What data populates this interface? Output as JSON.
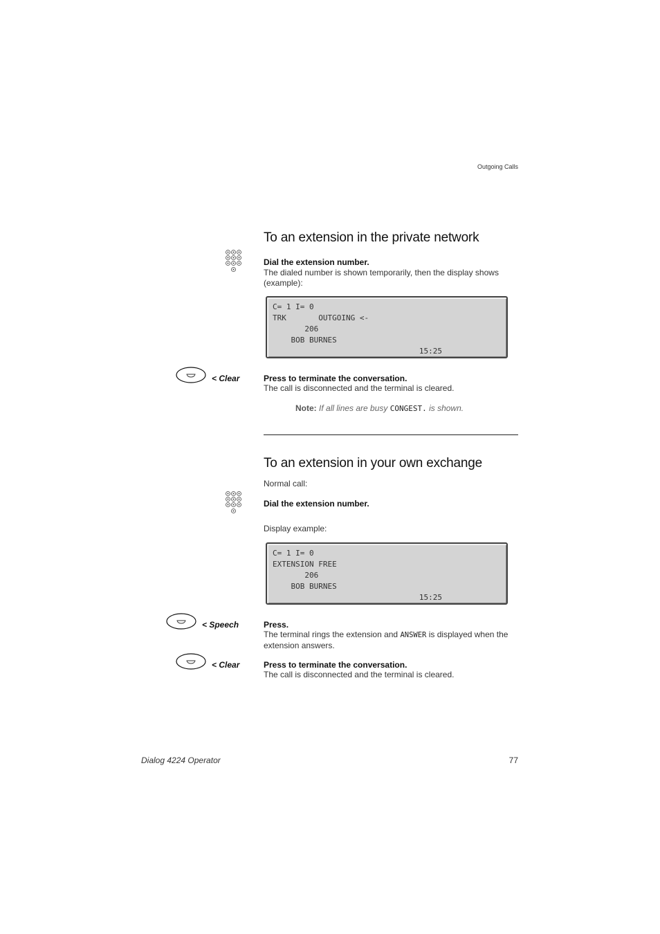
{
  "header": {
    "running_title": "Outgoing Calls"
  },
  "section1": {
    "title": "To an extension in the private network",
    "step1": {
      "icon": "keypad-icon",
      "heading": "Dial the extension number.",
      "text": "The dialed number is shown temporarily, then the display shows (example):"
    },
    "display": {
      "lines": [
        "C= 1 I= 0",
        "TRK       OUTGOING <-",
        "       206",
        "    BOB BURNES",
        "                                15:25"
      ]
    },
    "step2": {
      "icon": "key-button-icon",
      "key_label": "< Clear",
      "heading": "Press to terminate the conversation.",
      "text": "The call is disconnected and the terminal is cleared."
    },
    "note": {
      "label": "Note:",
      "text_before": "If all lines are busy",
      "code": "CONGEST.",
      "text_after": "is shown."
    }
  },
  "section2": {
    "title": "To an extension in your own exchange",
    "intro": "Normal call:",
    "step1": {
      "icon": "keypad-icon",
      "heading": "Dial the extension number."
    },
    "display_intro": "Display example:",
    "display": {
      "lines": [
        "C= 1 I= 0",
        "EXTENSION FREE",
        "       206",
        "    BOB BURNES",
        "                                15:25"
      ]
    },
    "step2": {
      "icon": "key-button-icon",
      "key_label": "< Speech",
      "heading": "Press.",
      "text_before": "The terminal rings the extension and",
      "code": "ANSWER",
      "text_after": "is displayed when the extension answers."
    },
    "step3": {
      "icon": "key-button-icon",
      "key_label": "< Clear",
      "heading": "Press to terminate the conversation.",
      "text": "The call is disconnected and the terminal is cleared."
    }
  },
  "footer": {
    "product": "Dialog 4224 Operator",
    "page_number": "77"
  }
}
